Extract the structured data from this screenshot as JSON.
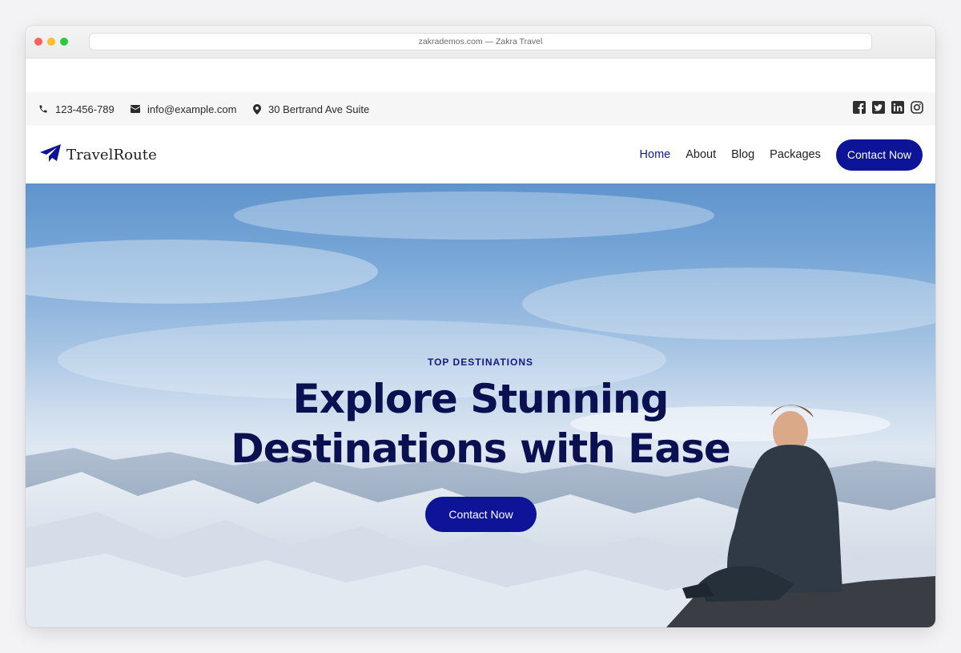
{
  "browser": {
    "address": "zakrademos.com — Zakra Travel"
  },
  "topbar": {
    "phone": "123-456-789",
    "email": "info@example.com",
    "address": "30 Bertrand Ave Suite",
    "social": [
      "facebook-icon",
      "twitter-icon",
      "linkedin-icon",
      "instagram-icon"
    ]
  },
  "header": {
    "logo_text": "TravelRoute",
    "nav": [
      {
        "label": "Home",
        "active": true
      },
      {
        "label": "About",
        "active": false
      },
      {
        "label": "Blog",
        "active": false
      },
      {
        "label": "Packages",
        "active": false
      }
    ],
    "cta_label": "Contact Now"
  },
  "hero": {
    "eyebrow": "TOP DESTINATIONS",
    "headline_line1": "Explore Stunning",
    "headline_line2": "Destinations with Ease",
    "button_label": "Contact Now"
  },
  "colors": {
    "brand": "#0d1497",
    "headline": "#0b1050",
    "topbar_bg": "#f6f6f7"
  }
}
